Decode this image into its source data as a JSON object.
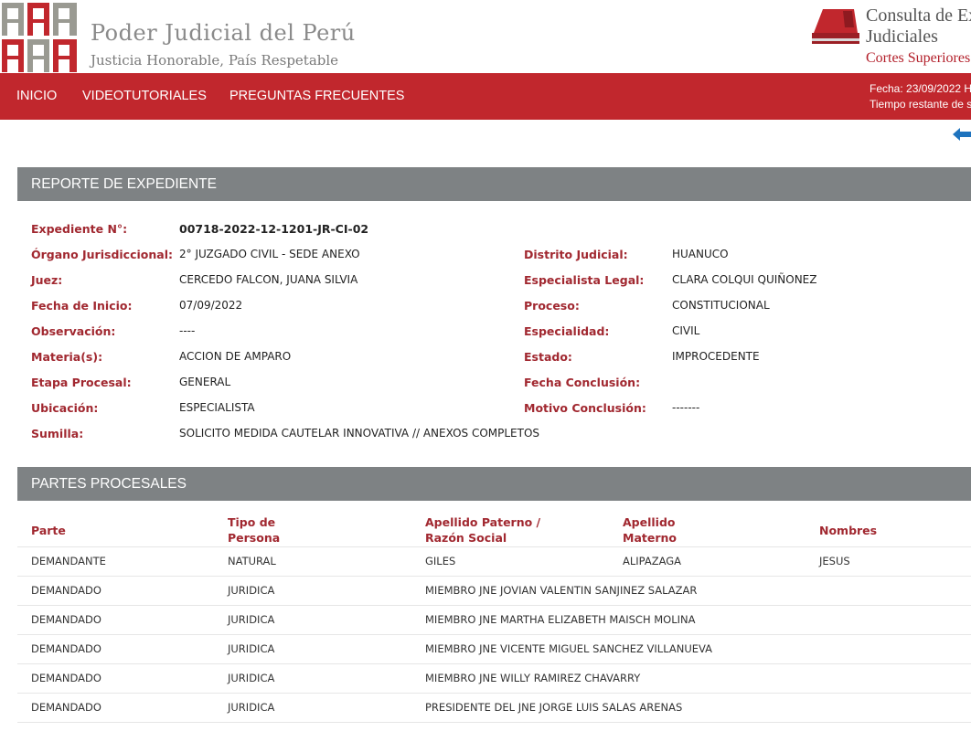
{
  "header": {
    "org_name": "Poder Judicial del Perú",
    "org_tagline": "Justicia Honorable, País Respetable",
    "app_title_line1": "Consulta de Ex",
    "app_title_line2": "Judiciales",
    "app_subtitle": "Cortes Superiores"
  },
  "nav": {
    "items": [
      "INICIO",
      "VIDEOTUTORIALES",
      "PREGUNTAS FRECUENTES"
    ],
    "date_text": "Fecha: 23/09/2022 H",
    "session_text": "Tiempo restante de s"
  },
  "colors": {
    "brand_red": "#c1272d",
    "label_red": "#a12830",
    "section_gray": "#7e8284"
  },
  "report": {
    "title": "REPORTE DE EXPEDIENTE",
    "expediente_label": "Expediente N°:",
    "expediente_value": "00718-2022-12-1201-JR-CI-02",
    "left": [
      {
        "label": "Órgano Jurisdiccional:",
        "value": "2° JUZGADO CIVIL - SEDE ANEXO"
      },
      {
        "label": "Juez:",
        "value": "CERCEDO FALCON, JUANA SILVIA"
      },
      {
        "label": "Fecha de Inicio:",
        "value": "07/09/2022"
      },
      {
        "label": "Observación:",
        "value": "----"
      },
      {
        "label": "Materia(s):",
        "value": "ACCION DE AMPARO"
      },
      {
        "label": "Etapa Procesal:",
        "value": "GENERAL"
      },
      {
        "label": "Ubicación:",
        "value": "ESPECIALISTA"
      },
      {
        "label": "Sumilla:",
        "value": "SOLICITO MEDIDA CAUTELAR INNOVATIVA // ANEXOS COMPLETOS"
      }
    ],
    "right": [
      {
        "label": "Distrito Judicial:",
        "value": "HUANUCO"
      },
      {
        "label": "Especialista Legal:",
        "value": "CLARA COLQUI QUIÑONEZ"
      },
      {
        "label": "Proceso:",
        "value": "CONSTITUCIONAL"
      },
      {
        "label": "Especialidad:",
        "value": "CIVIL"
      },
      {
        "label": "Estado:",
        "value": "IMPROCEDENTE"
      },
      {
        "label": "Fecha Conclusión:",
        "value": ""
      },
      {
        "label": "Motivo Conclusión:",
        "value": "-------"
      }
    ]
  },
  "partes": {
    "title": "PARTES PROCESALES",
    "headers": [
      "Parte",
      "Tipo de Persona",
      "Apellido Paterno / Razón Social",
      "Apellido Materno",
      "Nombres"
    ],
    "rows": [
      [
        "DEMANDANTE",
        "NATURAL",
        "GILES",
        "ALIPAZAGA",
        "JESUS"
      ],
      [
        "DEMANDADO",
        "JURIDICA",
        "MIEMBRO JNE JOVIAN VALENTIN SANJINEZ SALAZAR",
        "",
        ""
      ],
      [
        "DEMANDADO",
        "JURIDICA",
        "MIEMBRO JNE MARTHA ELIZABETH MAISCH MOLINA",
        "",
        ""
      ],
      [
        "DEMANDADO",
        "JURIDICA",
        "MIEMBRO JNE VICENTE MIGUEL SANCHEZ VILLANUEVA",
        "",
        ""
      ],
      [
        "DEMANDADO",
        "JURIDICA",
        "MIEMBRO JNE WILLY RAMIREZ CHAVARRY",
        "",
        ""
      ],
      [
        "DEMANDADO",
        "JURIDICA",
        "PRESIDENTE DEL JNE JORGE LUIS SALAS ARENAS",
        "",
        ""
      ]
    ]
  }
}
